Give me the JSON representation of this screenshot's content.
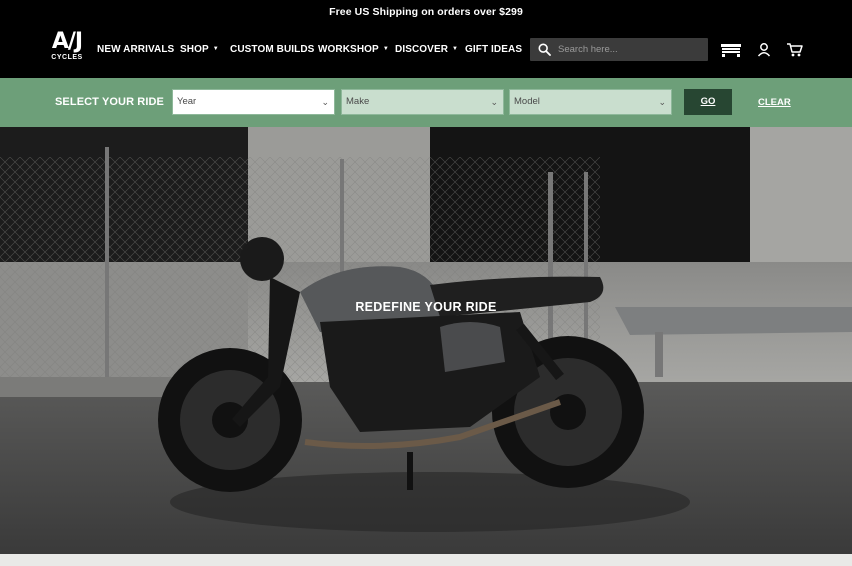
{
  "announcement": "Free US Shipping on orders over $299",
  "logo": {
    "mark": "A/J",
    "sub": "CYCLES"
  },
  "nav": {
    "items": [
      {
        "label": "NEW ARRIVALS",
        "has_dropdown": false
      },
      {
        "label": "SHOP",
        "has_dropdown": true
      },
      {
        "label": "CUSTOM BUILDS",
        "has_dropdown": false
      },
      {
        "label": "WORKSHOP",
        "has_dropdown": true
      },
      {
        "label": "DISCOVER",
        "has_dropdown": true
      },
      {
        "label": "GIFT IDEAS",
        "has_dropdown": false
      }
    ]
  },
  "search": {
    "placeholder": "Search here...",
    "icon": "search-icon"
  },
  "header_icons": [
    "garage-icon",
    "account-icon",
    "cart-icon"
  ],
  "ride_selector": {
    "label": "SELECT YOUR RIDE",
    "year_placeholder": "Year",
    "make_placeholder": "Make",
    "model_placeholder": "Model",
    "go_label": "GO",
    "clear_label": "CLEAR"
  },
  "hero": {
    "headline": "REDEFINE YOUR RIDE"
  },
  "colors": {
    "header_bg": "#000000",
    "ride_bar_bg": "#6d9f79",
    "go_button_bg": "#274632",
    "search_bg": "#3b3b3b"
  }
}
